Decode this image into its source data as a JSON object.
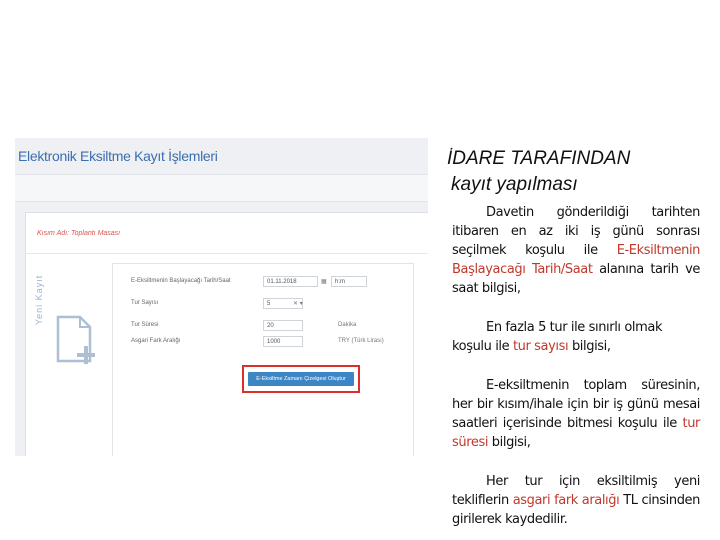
{
  "screenshot": {
    "title": "Elektronik Eksiltme Kayıt İşlemleri",
    "section_title": "Kısım Adı: Toplantı Masası",
    "vertical_label": "Yeni Kayıt",
    "fields": [
      {
        "label": "E-Eksiltmenin Başlayacağı Tarih/Saat",
        "value": "01.11.2018",
        "suffix": "h:m"
      },
      {
        "label": "Tur Sayısı",
        "value": "5"
      },
      {
        "label": "Tur Süresi",
        "value": "20",
        "suffix": "Dakika"
      },
      {
        "label": "Asgari Fark Aralığı",
        "value": "1000",
        "suffix": "TRY (Türk Lirası)"
      }
    ],
    "button_label": "E-Eksiltme Zamanı Çizelgesi Oluştur",
    "colors": {
      "title": "#3a6fb0",
      "button": "#3d86c6",
      "highlight_border": "#d9302b"
    }
  },
  "heading": {
    "line1": "İDARE TARAFINDAN",
    "line2": "kayıt yapılması"
  },
  "paragraphs": {
    "p1": {
      "a": "Davetin gönderildiği tarihten itibaren en az iki iş günü sonrası seçilmek koşulu ile ",
      "b": "E-Eksiltmenin Başlayacağı Tarih/Saat",
      "c": " alanına tarih ve saat bilgisi,"
    },
    "p2": {
      "a": "En fazla 5 tur ile sınırlı olmak koşulu ile ",
      "b": "tur sayısı",
      "c": " bilgisi,"
    },
    "p3": {
      "a": "E-eksiltmenin toplam süresinin, her bir kısım/ihale için bir iş günü mesai saatleri içerisinde bitmesi koşulu ile ",
      "b": "tur süresi",
      "c": " bilgisi,"
    },
    "p4": {
      "a": "Her tur için eksiltilmiş yeni tekliflerin ",
      "b": "asgari fark aralığı",
      "c": " TL cinsinden girilerek kaydedilir."
    }
  },
  "accent_color": "#c0392b"
}
